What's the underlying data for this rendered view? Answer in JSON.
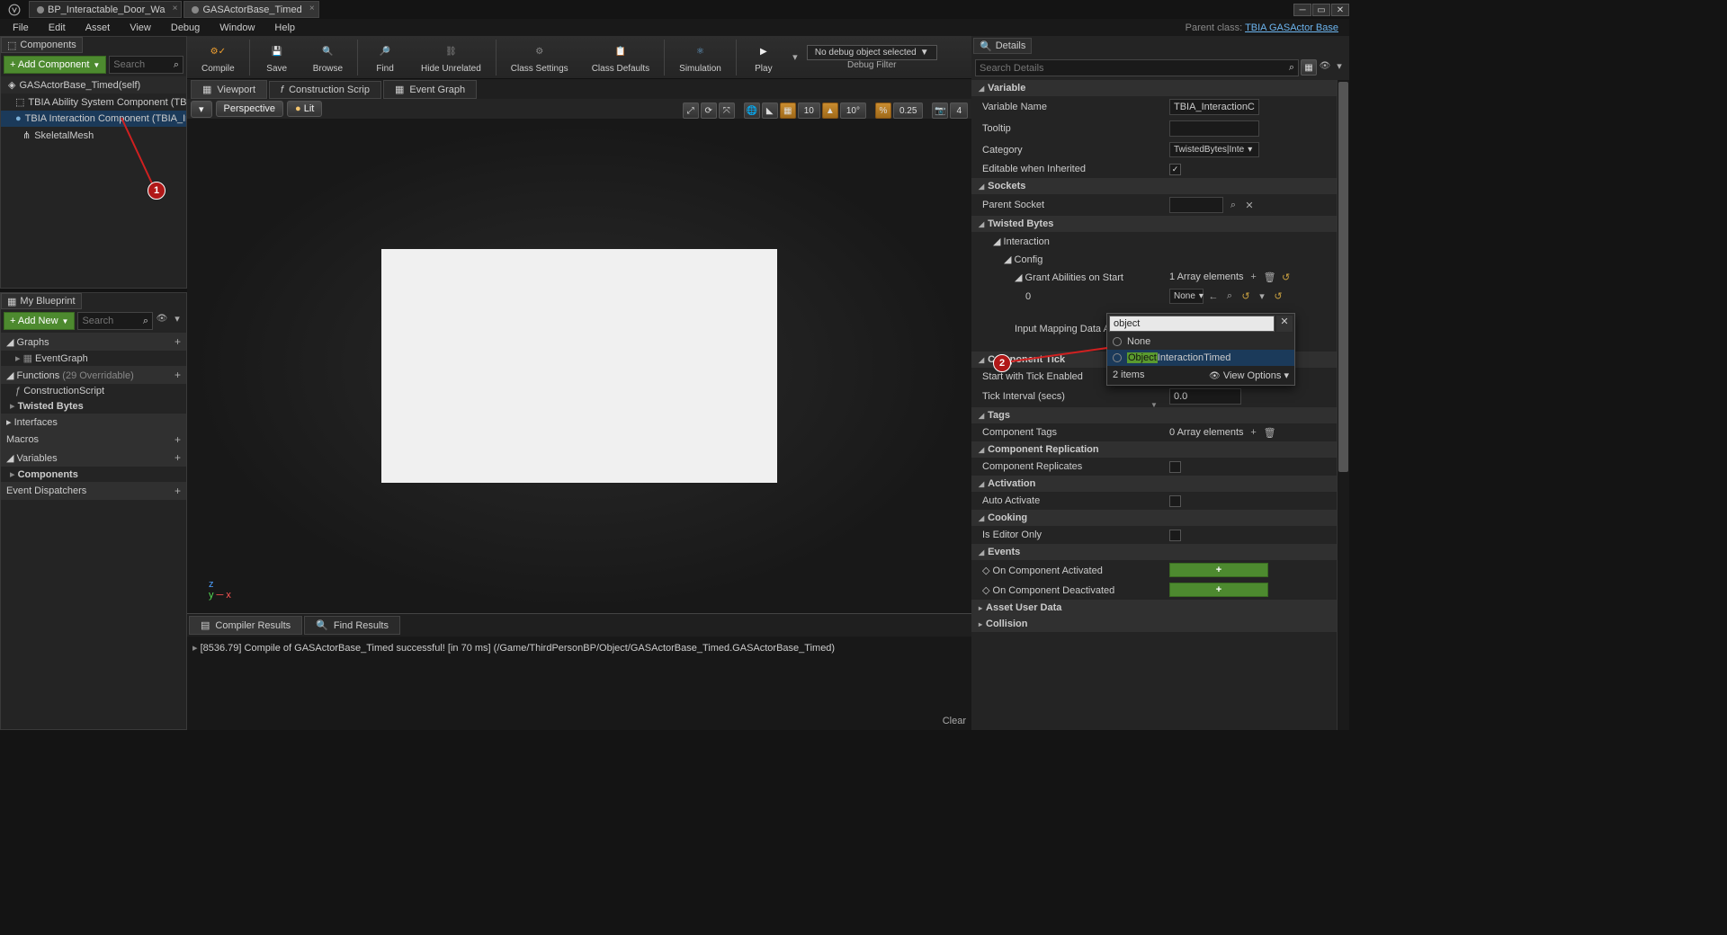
{
  "titlebar": {
    "tabs": [
      {
        "label": "BP_Interactable_Door_Wa",
        "active": false
      },
      {
        "label": "GASActorBase_Timed",
        "active": true
      }
    ]
  },
  "menubar": {
    "items": [
      "File",
      "Edit",
      "Asset",
      "View",
      "Debug",
      "Window",
      "Help"
    ],
    "parent_class_label": "Parent class:",
    "parent_class_link": "TBIA GASActor Base"
  },
  "components_panel": {
    "title": "Components",
    "add_button": "+ Add Component",
    "search_placeholder": "Search",
    "root": "GASActorBase_Timed(self)",
    "items": [
      "TBIA Ability System Component (TBIA_Al",
      "TBIA Interaction Component (TBIA_Intera",
      "SkeletalMesh"
    ]
  },
  "my_blueprint": {
    "title": "My Blueprint",
    "add_button": "+ Add New",
    "search_placeholder": "Search",
    "sections": {
      "graphs": "Graphs",
      "event_graph": "EventGraph",
      "functions": "Functions",
      "functions_note": "(29 Overridable)",
      "construction": "ConstructionScript",
      "twisted_bytes": "Twisted Bytes",
      "interfaces": "Interfaces",
      "macros": "Macros",
      "variables": "Variables",
      "components": "Components",
      "event_dispatchers": "Event Dispatchers"
    }
  },
  "toolbar": {
    "compile": "Compile",
    "save": "Save",
    "browse": "Browse",
    "find": "Find",
    "hide_unrelated": "Hide Unrelated",
    "class_settings": "Class Settings",
    "class_defaults": "Class Defaults",
    "simulation": "Simulation",
    "play": "Play",
    "debug_object": "No debug object selected",
    "debug_filter": "Debug Filter"
  },
  "subtabs": {
    "viewport": "Viewport",
    "construction": "Construction Scrip",
    "event_graph": "Event Graph"
  },
  "viewport": {
    "perspective": "Perspective",
    "lit": "Lit",
    "snap_angle": "10",
    "snap_deg": "10°",
    "snap_scale": "0.25",
    "camera_speed": "4"
  },
  "results": {
    "compiler_tab": "Compiler Results",
    "find_tab": "Find Results",
    "log_line": "[8536.79] Compile of GASActorBase_Timed successful! [in 70 ms] (/Game/ThirdPersonBP/Object/GASActorBase_Timed.GASActorBase_Timed)",
    "clear": "Clear"
  },
  "details": {
    "title": "Details",
    "search_placeholder": "Search Details",
    "variable": {
      "header": "Variable",
      "name_label": "Variable Name",
      "name_value": "TBIA_InteractionCompo",
      "tooltip": "Tooltip",
      "category": "Category",
      "category_value": "TwistedBytes|Inte",
      "editable": "Editable when Inherited"
    },
    "sockets": {
      "header": "Sockets",
      "parent_socket": "Parent Socket"
    },
    "twisted_bytes": {
      "header": "Twisted Bytes",
      "interaction": "Interaction",
      "config": "Config",
      "grant_abilities": "Grant Abilities on Start",
      "array_count": "1 Array elements",
      "index0": "0",
      "none_dd": "None",
      "input_mapping": "Input Mapping Data Asset"
    },
    "asset_popup": {
      "search_value": "object",
      "none": "None",
      "object_highlight": "Object",
      "object_rest": "InteractionTimed",
      "footer_count": "2 items",
      "view_options": "View Options"
    },
    "component_tick": {
      "header": "Component Tick",
      "start_enabled": "Start with Tick Enabled",
      "interval": "Tick Interval (secs)",
      "interval_value": "0.0"
    },
    "tags": {
      "header": "Tags",
      "component_tags": "Component Tags",
      "array_count": "0 Array elements"
    },
    "replication": {
      "header": "Component Replication",
      "replicates": "Component Replicates"
    },
    "activation": {
      "header": "Activation",
      "auto_activate": "Auto Activate"
    },
    "cooking": {
      "header": "Cooking",
      "editor_only": "Is Editor Only"
    },
    "events": {
      "header": "Events",
      "activated": "On Component Activated",
      "deactivated": "On Component Deactivated"
    },
    "asset_user_data": "Asset User Data",
    "collision": "Collision"
  },
  "annotations": {
    "badge1": "1",
    "badge2": "2"
  }
}
